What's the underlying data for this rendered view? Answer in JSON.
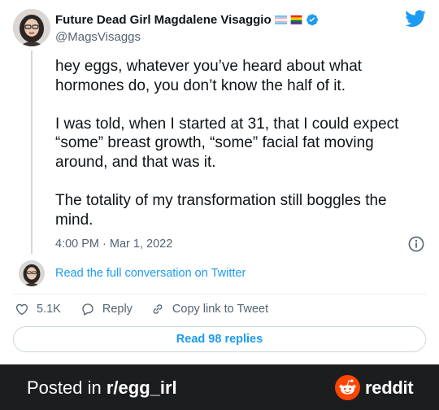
{
  "tweet": {
    "author": {
      "display_name": "Future Dead Girl Magdalene Visaggio",
      "handle": "@MagsVisaggs",
      "verified": true,
      "flags": [
        "transgender-flag",
        "rainbow-flag"
      ]
    },
    "paragraphs": [
      [
        "hey eggs, whatever you’ve heard about what",
        "hormones do, you don’t know the half of it."
      ],
      [
        "I was told, when I started at 31, that I could expect",
        "“some” breast growth, “some” facial fat moving",
        "around, and that was it."
      ],
      [
        "The totality of my transformation still boggles the",
        "mind."
      ]
    ],
    "timestamp": "4:00 PM · Mar 1, 2022",
    "read_conversation": "Read the full conversation on Twitter",
    "actions": {
      "likes": "5.1K",
      "reply": "Reply",
      "copy_link": "Copy link to Tweet"
    },
    "read_replies": "Read 98 replies"
  },
  "footer": {
    "posted_prefix": "Posted in ",
    "subreddit": "r/egg_irl",
    "brand": "reddit"
  },
  "colors": {
    "twitter_blue": "#1d9bf0",
    "text_primary": "#0f1419",
    "text_secondary": "#536471",
    "footer_bg": "#1b1d1f",
    "reddit_orange": "#ff4500"
  },
  "icons": [
    "twitter-bird-icon",
    "verified-badge-icon",
    "info-icon",
    "heart-icon",
    "reply-bubble-icon",
    "link-icon",
    "reddit-snoo-icon"
  ]
}
